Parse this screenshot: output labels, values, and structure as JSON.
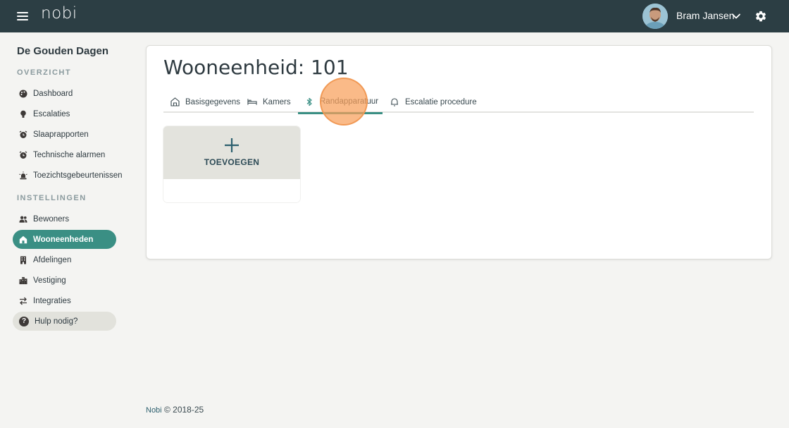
{
  "header": {
    "logo": "nobi",
    "user_name": "Bram Jansen"
  },
  "sidebar": {
    "org_name": "De Gouden Dagen",
    "overview_label": "OVERZICHT",
    "overview_items": [
      {
        "label": "Dashboard",
        "icon": "palette-icon"
      },
      {
        "label": "Escalaties",
        "icon": "lightbulb-icon"
      },
      {
        "label": "Slaaprapporten",
        "icon": "alarm-clock-icon"
      },
      {
        "label": "Technische alarmen",
        "icon": "alarm-clock-icon"
      },
      {
        "label": "Toezichtsgebeurtenissen",
        "icon": "siren-icon"
      }
    ],
    "settings_label": "INSTELLINGEN",
    "settings_items": [
      {
        "label": "Bewoners",
        "icon": "users-icon"
      },
      {
        "label": "Wooneenheden",
        "icon": "home-icon",
        "active": true
      },
      {
        "label": "Afdelingen",
        "icon": "building-icon"
      },
      {
        "label": "Vestiging",
        "icon": "city-icon"
      },
      {
        "label": "Integraties",
        "icon": "swap-arrows-icon"
      }
    ],
    "help_label": "Hulp nodig?"
  },
  "main": {
    "title": "Wooneenheid: 101",
    "tabs": [
      {
        "label": "Basisgegevens",
        "icon": "house-outline-icon"
      },
      {
        "label": "Kamers",
        "icon": "bed-icon"
      },
      {
        "label": "Randapparatuur",
        "icon": "bluetooth-icon",
        "active": true
      },
      {
        "label": "Escalatie procedure",
        "icon": "bell-icon"
      }
    ],
    "add_label": "TOEVOEGEN"
  },
  "footer": {
    "brand": "Nobi",
    "copyright": "© 2018-25"
  },
  "colors": {
    "topbar": "#2c3e44",
    "accent": "#3a8f84",
    "click_indicator": "#f8a05a"
  }
}
